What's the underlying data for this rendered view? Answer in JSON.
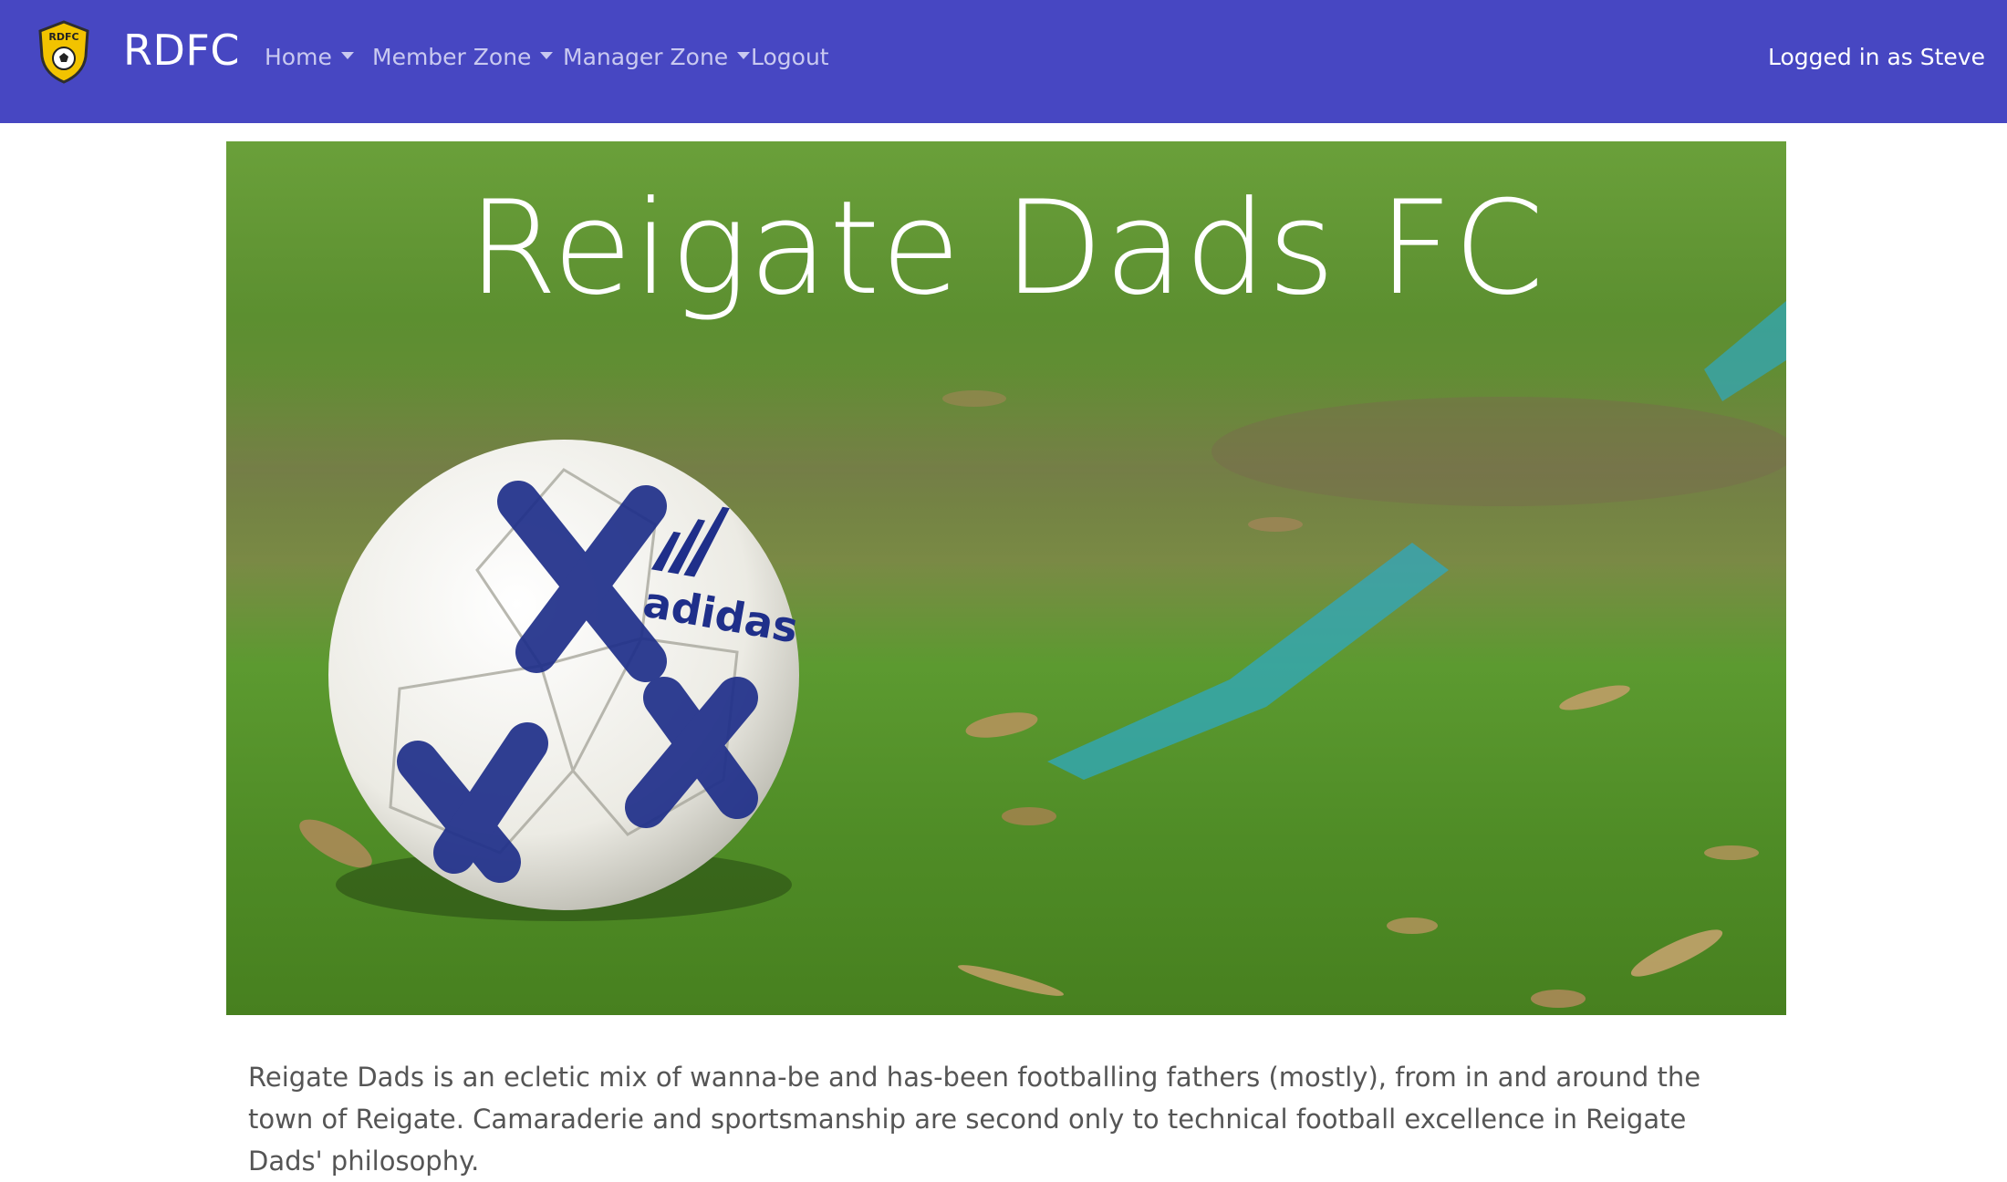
{
  "brand": {
    "logo_text": "RDFC",
    "name": "RDFC",
    "logo_colors": {
      "shield": "#f2c300",
      "outline": "#3a3a3a"
    }
  },
  "nav": {
    "items": [
      {
        "label": "Home",
        "dropdown": true
      },
      {
        "label": "Member Zone",
        "dropdown": true
      },
      {
        "label": "Manager Zone",
        "dropdown": true
      },
      {
        "label": "Logout",
        "dropdown": false
      }
    ],
    "user_status": "Logged in as Steve"
  },
  "hero": {
    "title": "Reigate Dads FC",
    "ball_brand": "adidas"
  },
  "intro": {
    "text": "Reigate Dads is an ecletic mix of wanna-be and has-been footballing fathers (mostly), from in and around the town of Reigate. Camaraderie and sportsmanship are second only to technical football excellence in Reigate Dads' philosophy."
  },
  "colors": {
    "navbar": "#4747c2",
    "nav_link": "#c9c9f0",
    "grass": "#5c9a30",
    "paint_line": "#2fa8c0",
    "ball_pattern": "#1f2f8a"
  }
}
